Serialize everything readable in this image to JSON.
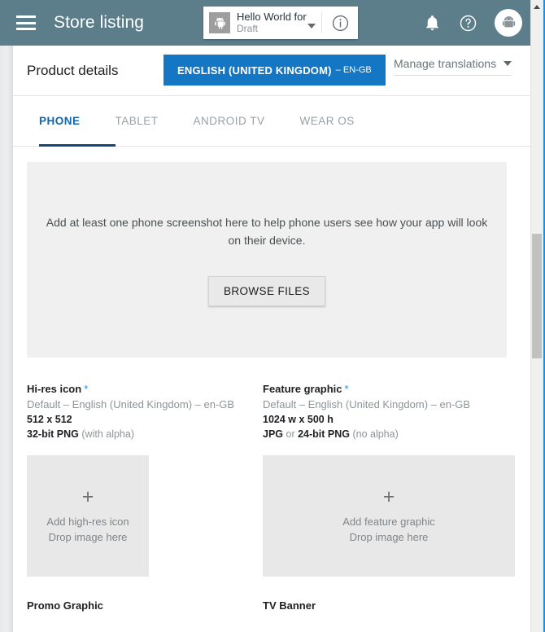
{
  "appbar": {
    "menu_icon": "hamburger-menu-icon",
    "title": "Store listing",
    "app_chip": {
      "icon": "android-robot-icon",
      "name": "Hello World for Android",
      "status": "Draft",
      "caret_icon": "chevron-down-icon",
      "info_icon": "info-circle-icon"
    },
    "notifications_icon": "bell-icon",
    "help_icon": "help-circle-icon",
    "avatar_icon": "android-avatar-icon"
  },
  "card_header": {
    "title": "Product details",
    "language_button": {
      "label": "ENGLISH (UNITED KINGDOM)",
      "separator": "–",
      "code": "EN-GB"
    },
    "manage_translations": {
      "label": "Manage translations",
      "caret_icon": "chevron-down-icon"
    }
  },
  "tabs": [
    {
      "label": "PHONE",
      "active": true
    },
    {
      "label": "TABLET",
      "active": false
    },
    {
      "label": "ANDROID TV",
      "active": false
    },
    {
      "label": "WEAR OS",
      "active": false
    }
  ],
  "screenshot_dropzone": {
    "message": "Add at least one phone screenshot here to help phone users see how your app will look on their device.",
    "browse_label": "BROWSE FILES"
  },
  "assets": [
    {
      "title": "Hi-res icon",
      "required_marker": "*",
      "default_line": "Default – English (United Kingdom) – en-GB",
      "size": "512 x 512",
      "format_bold": "32-bit PNG",
      "format_normal": " (with alpha)",
      "drop_plus": "+",
      "drop_line1": "Add high-res icon",
      "drop_line2": "Drop image here"
    },
    {
      "title": "Feature graphic",
      "required_marker": "*",
      "default_line": "Default – English (United Kingdom) – en-GB",
      "size": "1024 w x 500 h",
      "format_bold": "JPG",
      "format_mid": " or ",
      "format_bold2": "24-bit PNG",
      "format_normal": " (no alpha)",
      "drop_plus": "+",
      "drop_line1": "Add feature graphic",
      "drop_line2": "Drop image here"
    }
  ],
  "bottom_assets": [
    {
      "title": "Promo Graphic"
    },
    {
      "title": "TV Banner"
    }
  ],
  "scrollbar": {
    "up_arrow_icon": "caret-up-icon"
  },
  "colors": {
    "appbar": "#5c7d8a",
    "accent_blue": "#1577c4",
    "tab_active": "#17477d",
    "required_star": "#1a8fe0"
  }
}
